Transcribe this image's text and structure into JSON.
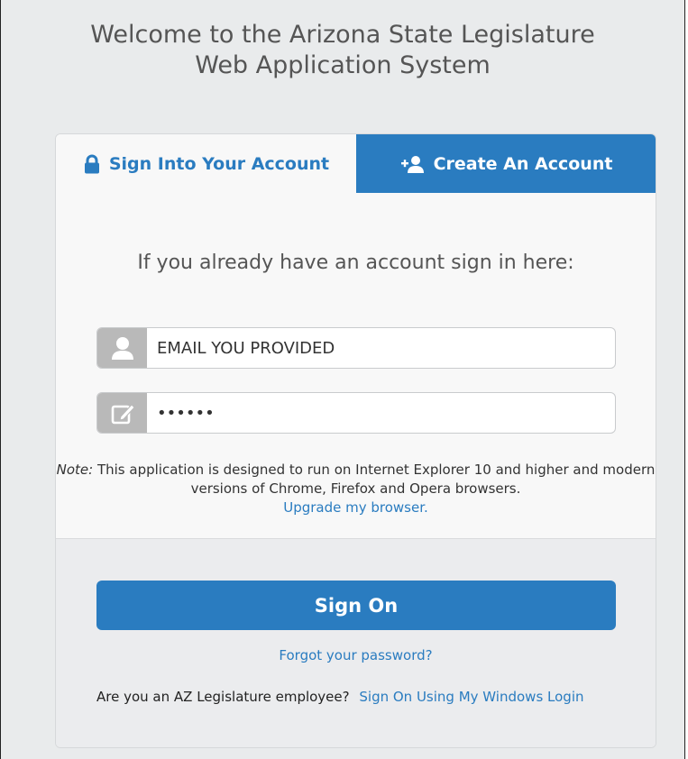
{
  "header": {
    "title_line1": "Welcome to the Arizona State Legislature",
    "title_line2": "Web Application System"
  },
  "tabs": [
    {
      "label": "Sign Into Your Account",
      "icon": "lock-icon",
      "active": true
    },
    {
      "label": "Create An Account",
      "icon": "add-user-icon",
      "active": false
    }
  ],
  "form": {
    "lead": "If you already have an account sign in here:",
    "email_value": "EMAIL YOU PROVIDED",
    "password_value": "••••••",
    "note_prefix": "Note:",
    "note_text": " This application is designed to run on Internet Explorer 10 and higher and modern versions of Chrome, Firefox and Opera browsers.",
    "upgrade_link": "Upgrade my browser."
  },
  "footer": {
    "signon_label": "Sign On",
    "forgot_link": "Forgot your password?",
    "employee_question": "Are you an AZ Legislature employee?",
    "windows_login_link": "Sign On Using My Windows Login"
  },
  "colors": {
    "accent": "#2a7cc0",
    "background": "#e9ebec",
    "addon": "#b9b9b9"
  }
}
